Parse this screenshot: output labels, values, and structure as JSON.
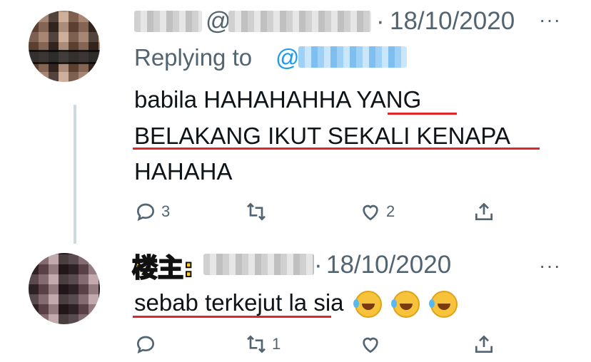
{
  "tweets": [
    {
      "at": "@",
      "date": "18/10/2020",
      "dot": "·",
      "replying_prefix": "Replying to",
      "replying_at": "@",
      "lines": [
        "babila HAHAHAHHA YANG",
        "BELAKANG IKUT SEKALI KENAPA",
        "HAHAHA"
      ],
      "actions": {
        "reply_count": "3",
        "retweet_count": "",
        "like_count": "2"
      },
      "more": "···"
    },
    {
      "badge": "楼主:",
      "date": "18/10/2020",
      "dot": "·",
      "text": "sebab terkejut la sia",
      "actions": {
        "reply_count": "",
        "retweet_count": "1",
        "like_count": ""
      },
      "more": "···"
    }
  ],
  "icons": [
    "reply-icon",
    "retweet-icon",
    "like-icon",
    "share-icon",
    "more-icon",
    "rofl-emoji"
  ],
  "colors": {
    "underline": "#e0262b",
    "link": "#1d9bf0",
    "meta": "#536471",
    "thread_line": "#cfd9de",
    "badge": "#ffd21a"
  }
}
